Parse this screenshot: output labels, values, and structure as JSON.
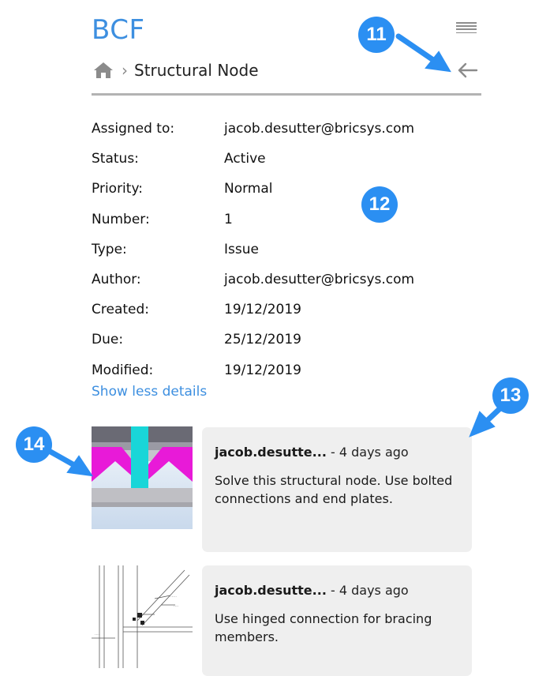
{
  "app": {
    "title": "BCF"
  },
  "breadcrumb": {
    "separator": "›",
    "current": "Structural Node"
  },
  "icons": {
    "menu": "hamburger-menu-icon",
    "home": "home-icon",
    "back": "back-arrow-icon"
  },
  "details": [
    {
      "label": "Assigned to:",
      "value": "jacob.desutter@bricsys.com"
    },
    {
      "label": "Status:",
      "value": "Active"
    },
    {
      "label": "Priority:",
      "value": "Normal"
    },
    {
      "label": "Number:",
      "value": "1"
    },
    {
      "label": "Type:",
      "value": "Issue"
    },
    {
      "label": "Author:",
      "value": "jacob.desutter@bricsys.com"
    },
    {
      "label": "Created:",
      "value": "19/12/2019"
    },
    {
      "label": "Due:",
      "value": "25/12/2019"
    },
    {
      "label": "Modified:",
      "value": "19/12/2019"
    }
  ],
  "show_less_label": "Show less details",
  "comments": [
    {
      "author": "jacob.desutte...",
      "time": "- 4 days ago",
      "text": "Solve this structural node. Use bolted connections and end plates."
    },
    {
      "author": "jacob.desutte...",
      "time": "- 4 days ago",
      "text": "Use hinged connection for bracing members."
    }
  ],
  "callouts": [
    "11",
    "12",
    "13",
    "14"
  ],
  "colors": {
    "accent": "#3d8fe0",
    "callout": "#2b8ff2",
    "comment_bg": "#efefef",
    "divider": "#b3b3b3"
  }
}
